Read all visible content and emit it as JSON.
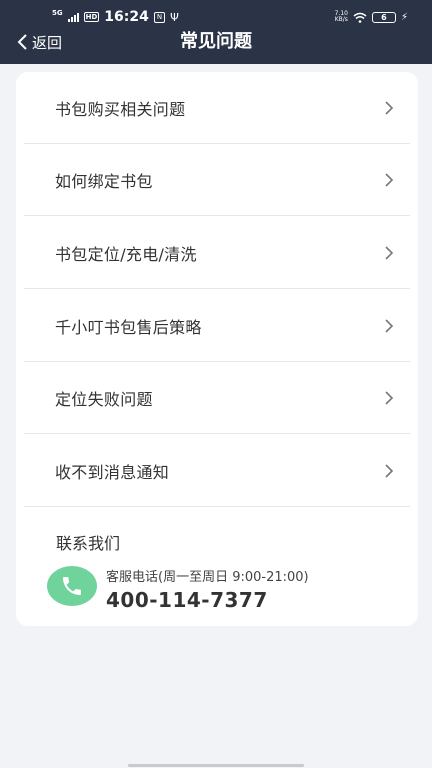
{
  "status_bar": {
    "network": "5G",
    "hd": "HD",
    "time": "16:24",
    "mini_badge": "N",
    "usb": "Ψ",
    "net_speed_value": "7.10",
    "net_speed_unit": "KB/s",
    "battery": "6"
  },
  "header": {
    "back_label": "返回",
    "title": "常见问题"
  },
  "faq": {
    "items": [
      {
        "label": "书包购买相关问题"
      },
      {
        "label": "如何绑定书包"
      },
      {
        "label": "书包定位/充电/清洗"
      },
      {
        "label": "千小叮书包售后策略"
      },
      {
        "label": "定位失败问题"
      },
      {
        "label": "收不到消息通知"
      }
    ]
  },
  "contact": {
    "title": "联系我们",
    "service_label": "客服电话(周一至周日 9:00-21:00)",
    "phone": "400-114-7377"
  },
  "colors": {
    "header_bg": "#2b3447",
    "page_bg": "#f2f3f7",
    "phone_icon_bg": "#6fd39b"
  }
}
